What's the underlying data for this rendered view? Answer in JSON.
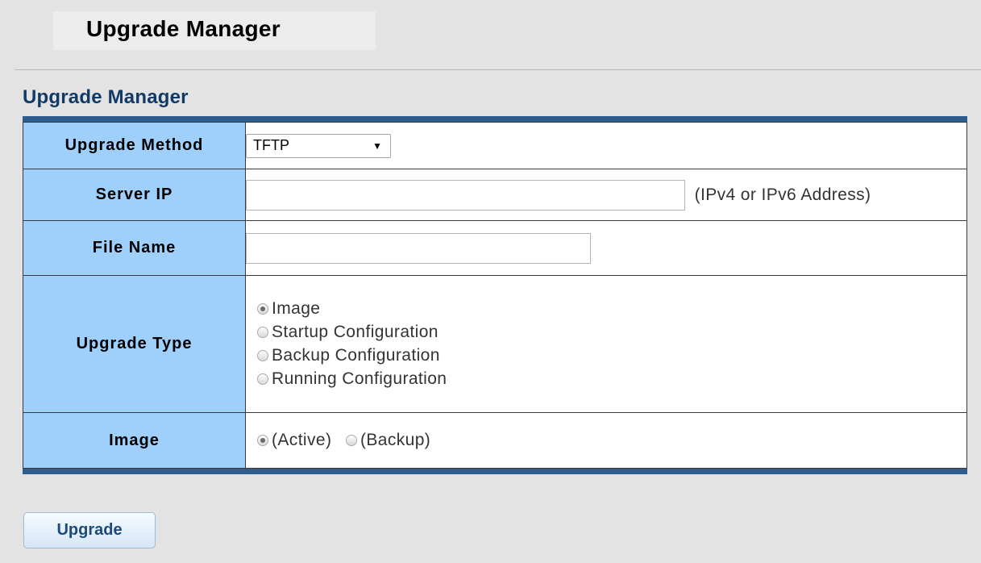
{
  "page": {
    "header_title": "Upgrade Manager",
    "section_title": "Upgrade Manager"
  },
  "form": {
    "upgrade_method": {
      "label": "Upgrade Method",
      "selected": "TFTP"
    },
    "server_ip": {
      "label": "Server IP",
      "value": "",
      "hint": "(IPv4 or IPv6 Address)"
    },
    "file_name": {
      "label": "File Name",
      "value": ""
    },
    "upgrade_type": {
      "label": "Upgrade Type",
      "options": [
        {
          "label": "Image",
          "checked": true
        },
        {
          "label": "Startup Configuration",
          "checked": false
        },
        {
          "label": "Backup Configuration",
          "checked": false
        },
        {
          "label": "Running Configuration",
          "checked": false
        }
      ]
    },
    "image": {
      "label": "Image",
      "options": [
        {
          "label": "(Active)",
          "checked": true
        },
        {
          "label": "(Backup)",
          "checked": false
        }
      ]
    }
  },
  "actions": {
    "upgrade_label": "Upgrade"
  },
  "icons": {
    "dropdown": "chevron-down-icon",
    "radio": "radio-icon"
  },
  "colors": {
    "label_bg": "#9fd0fb",
    "panel_border": "#2f5e8e",
    "section_title": "#123a66",
    "button_text": "#1d4a78"
  }
}
